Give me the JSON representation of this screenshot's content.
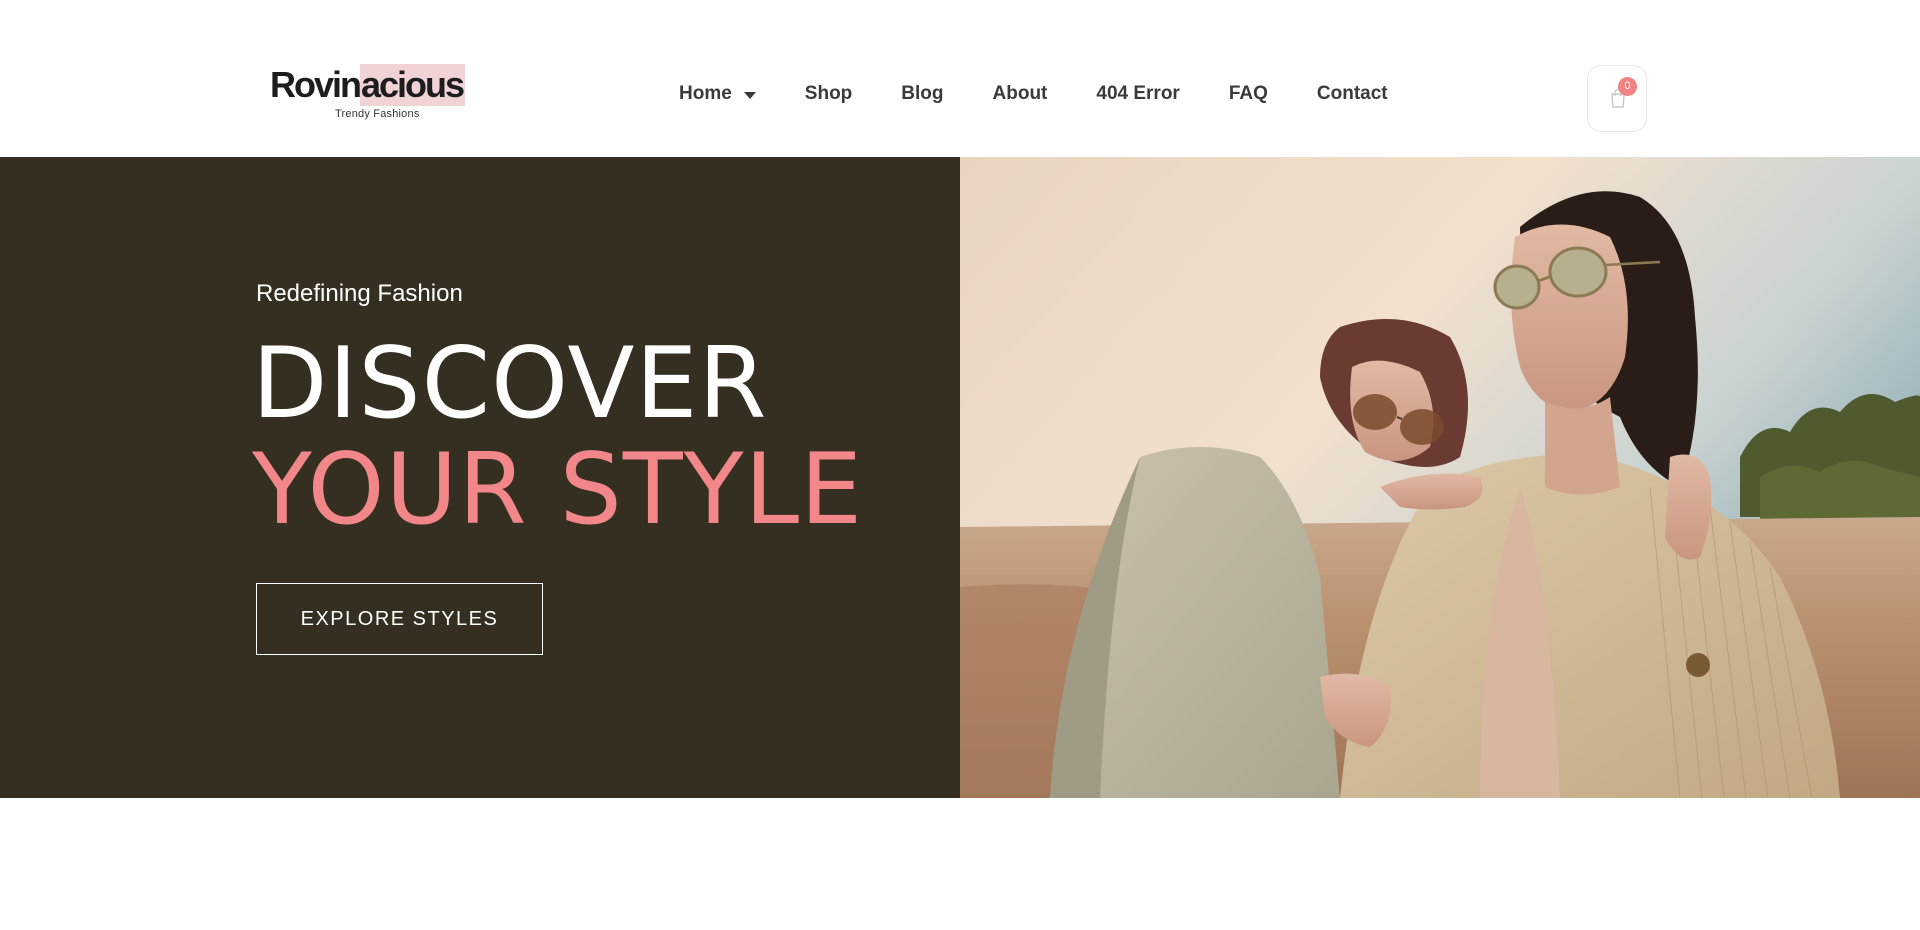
{
  "brand": {
    "name_part1": "Rovin",
    "name_part2": "acious",
    "tagline": "Trendy Fashions",
    "accent_color": "#f2878a",
    "highlight_color": "#f2d3d5"
  },
  "nav": {
    "items": [
      {
        "label": "Home",
        "has_dropdown": true
      },
      {
        "label": "Shop"
      },
      {
        "label": "Blog"
      },
      {
        "label": "About"
      },
      {
        "label": "404 Error"
      },
      {
        "label": "FAQ"
      },
      {
        "label": "Contact"
      }
    ]
  },
  "cart": {
    "count": "0",
    "icon": "shopping-bag-icon"
  },
  "hero": {
    "eyebrow": "Redefining Fashion",
    "headline_line1": "DISCOVER",
    "headline_line2": "YOUR STYLE",
    "cta_label": "EXPLORE STYLES",
    "background_color": "#342f21",
    "image": "two women in blazers and sunglasses in a wheat field"
  }
}
